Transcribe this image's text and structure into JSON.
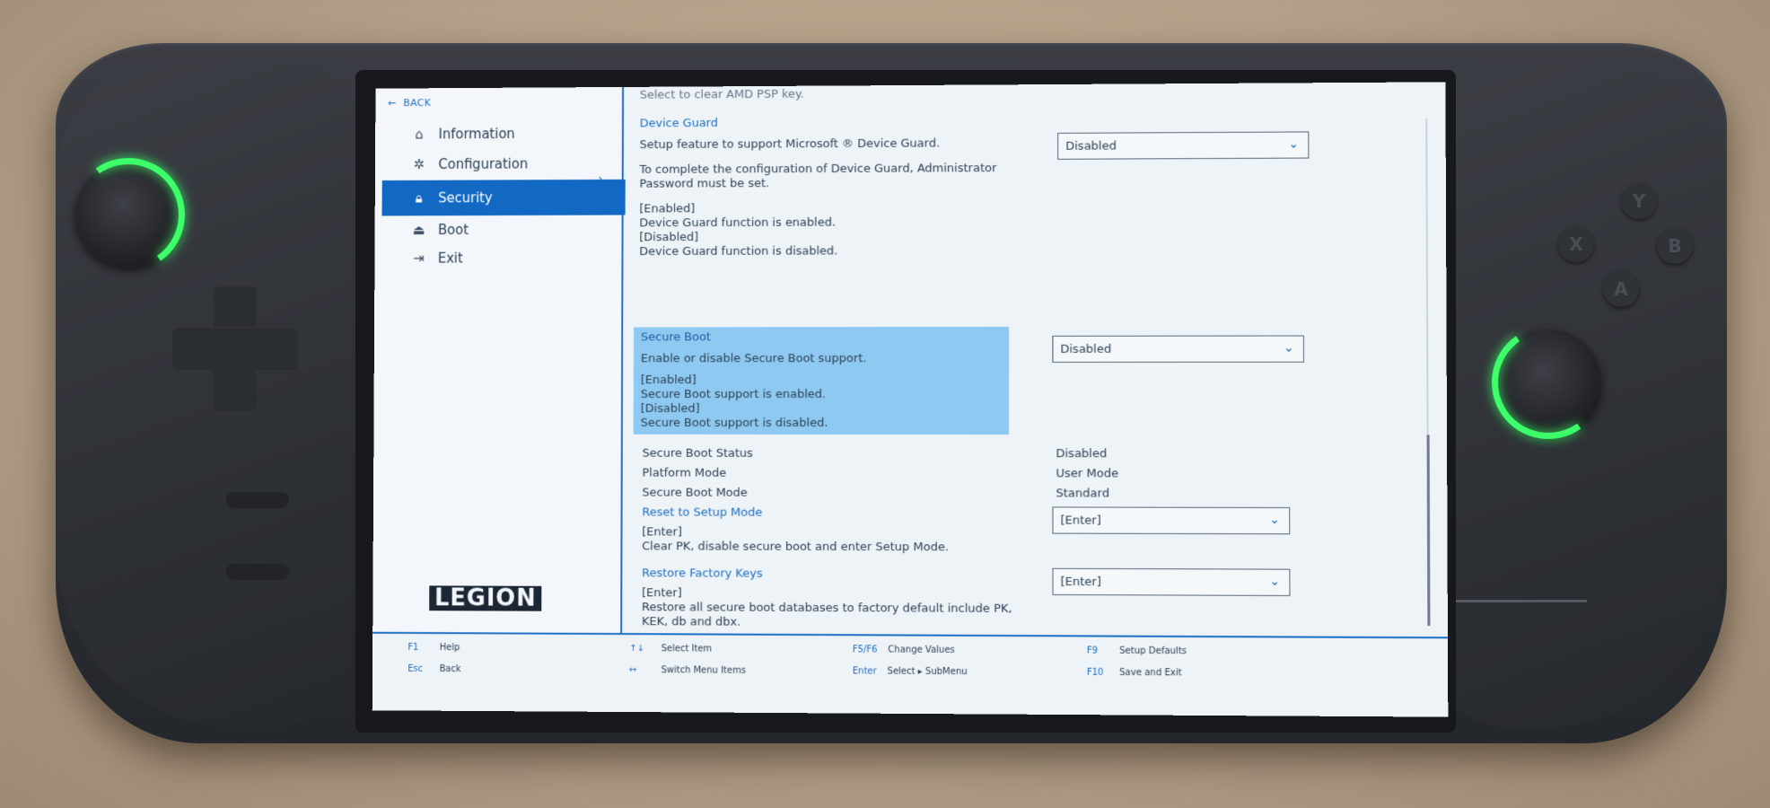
{
  "nav": {
    "back": "BACK",
    "items": [
      {
        "label": "Information",
        "icon": "home-icon"
      },
      {
        "label": "Configuration",
        "icon": "configuration-icon"
      },
      {
        "label": "Security",
        "icon": "lock-icon",
        "active": true
      },
      {
        "label": "Boot",
        "icon": "boot-icon"
      },
      {
        "label": "Exit",
        "icon": "exit-icon"
      }
    ],
    "logo": "LEGION"
  },
  "content": {
    "clipped_top": "Select to clear AMD PSP key.",
    "device_guard": {
      "title": "Device Guard",
      "desc": "Setup feature to support Microsoft ® Device Guard.",
      "note_line1": "To complete the configuration of Device Guard, Administrator",
      "note_line2": "Password must be set.",
      "opt1": "[Enabled]",
      "opt1_desc": "Device Guard function is enabled.",
      "opt2": "[Disabled]",
      "opt2_desc": "Device Guard function is disabled.",
      "value": "Disabled"
    },
    "secure_boot": {
      "title": "Secure Boot",
      "desc": "Enable or disable Secure Boot support.",
      "opt1": "[Enabled]",
      "opt1_desc": "Secure Boot support is enabled.",
      "opt2": "[Disabled]",
      "opt2_desc": "Secure Boot support is disabled.",
      "value": "Disabled"
    },
    "status_rows": [
      {
        "label": "Secure Boot Status",
        "value": "Disabled"
      },
      {
        "label": "Platform Mode",
        "value": "User Mode"
      },
      {
        "label": "Secure Boot Mode",
        "value": "Standard"
      }
    ],
    "reset_setup": {
      "title": "Reset to Setup Mode",
      "line1": "[Enter]",
      "line2": "Clear PK, disable secure boot and enter Setup Mode.",
      "value": "[Enter]"
    },
    "restore_keys": {
      "title": "Restore Factory Keys",
      "line1": "[Enter]",
      "line2": "Restore all secure boot databases to factory default include PK,",
      "line3": "KEK, db and dbx.",
      "value": "[Enter]"
    }
  },
  "footer": {
    "keys": [
      {
        "key": "F1",
        "label": "Help"
      },
      {
        "key": "Esc",
        "label": "Back"
      },
      {
        "key": "↑↓",
        "label": "Select Item"
      },
      {
        "key": "↔",
        "label": "Switch Menu Items"
      },
      {
        "key": "F5/F6",
        "label": "Change Values"
      },
      {
        "key": "Enter",
        "label": "Select ▸ SubMenu"
      },
      {
        "key": "F9",
        "label": "Setup Defaults"
      },
      {
        "key": "F10",
        "label": "Save and Exit"
      }
    ]
  },
  "device": {
    "face_buttons": [
      "Y",
      "X",
      "B",
      "A"
    ],
    "accent_color": "#3cff6a",
    "highlight_color": "#8ec9f2",
    "active_nav_color": "#1268c2"
  }
}
